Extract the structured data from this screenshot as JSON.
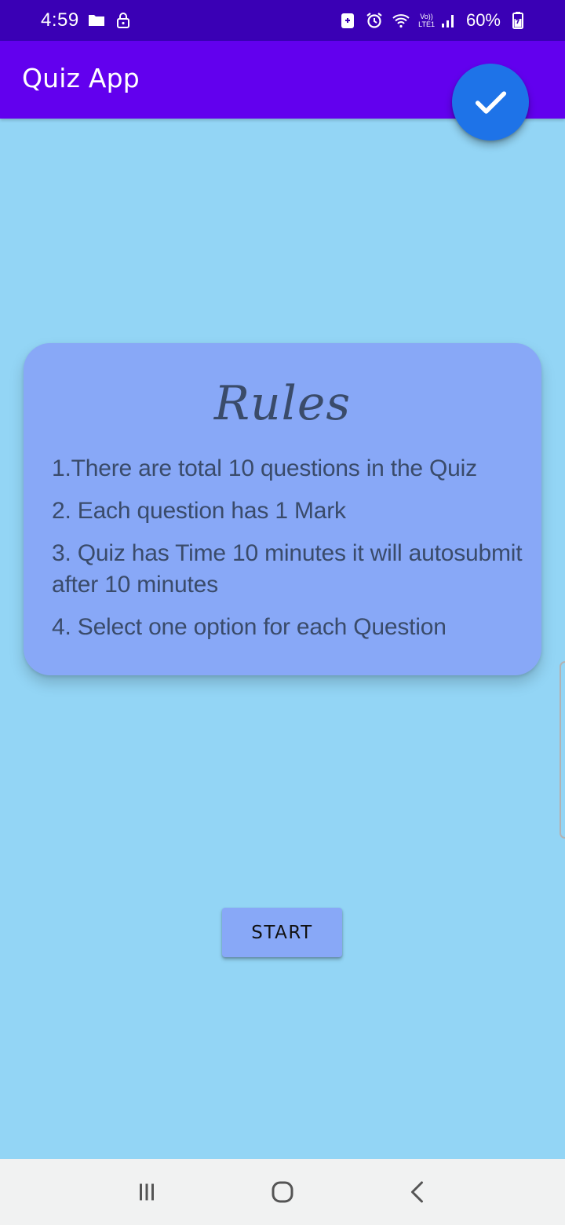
{
  "status_bar": {
    "time": "4:59",
    "network_top": "Vo))",
    "network_bottom": "LTE1",
    "battery_percent": "60%",
    "icons": [
      "folder-icon",
      "lock-icon",
      "battery-saver-icon",
      "alarm-icon",
      "wifi-icon",
      "signal-icon",
      "battery-icon"
    ]
  },
  "app_bar": {
    "title": "Quiz App",
    "fab_icon": "check-icon"
  },
  "rules": {
    "title": "Rules",
    "items": [
      "1.There are total 10 questions in the Quiz",
      "2. Each question has 1 Mark",
      "3. Quiz has Time 10 minutes it will autosubmit after 10 minutes",
      "4. Select one option for each Question"
    ]
  },
  "start_button": {
    "label": "START"
  },
  "nav_bar": {
    "items": [
      "recent-apps-icon",
      "home-icon",
      "back-icon"
    ]
  },
  "colors": {
    "background": "#93d5f5",
    "status_bar": "#3a00b5",
    "app_bar": "#6200ee",
    "fab": "#1e73e8",
    "card": "#88a8f7",
    "text": "#3a4b6a"
  }
}
